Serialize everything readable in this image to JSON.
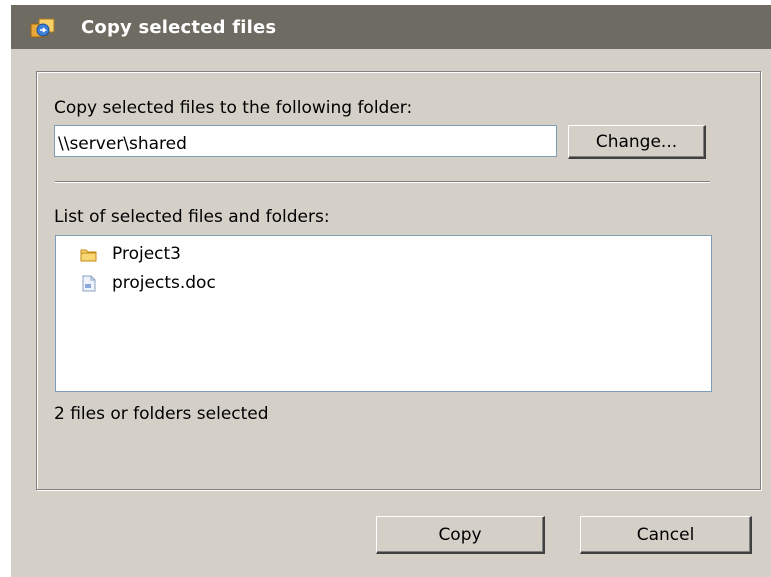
{
  "window": {
    "title": "Copy selected files",
    "title_icon": "copy-files-icon"
  },
  "destination": {
    "label": "Copy selected files to the following folder:",
    "folder_value": "\\\\server\\shared",
    "change_button": "Change..."
  },
  "selection": {
    "label": "List of selected files and folders:",
    "items": [
      {
        "name": "Project3",
        "icon": "folder-icon"
      },
      {
        "name": "projects.doc",
        "icon": "document-icon"
      }
    ],
    "status": "2 files or folders selected"
  },
  "buttons": {
    "copy": "Copy",
    "cancel": "Cancel"
  },
  "colors": {
    "titlebar": "#6e6c62",
    "dialog_bg": "#d4d0c8",
    "input_border": "#7f9db9"
  }
}
